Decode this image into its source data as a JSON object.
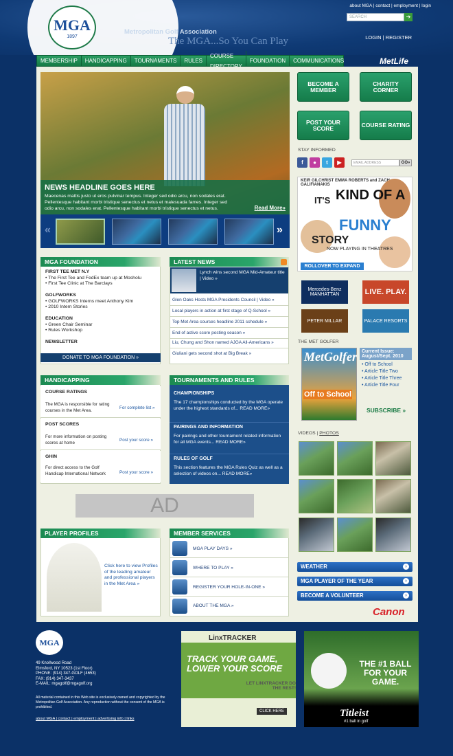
{
  "header": {
    "logo_text": "MGA",
    "logo_year": "1897",
    "org": "Metropolitan Golf Association",
    "tagline": "The MGA...So You Can Play",
    "top_links": [
      "about MGA",
      "contact",
      "employment",
      "login"
    ],
    "search_placeholder": "SEARCH",
    "login": "LOGIN",
    "register": "REGISTER",
    "sponsor": "MetLife"
  },
  "nav": [
    "MEMBERSHIP",
    "HANDICAPPING",
    "TOURNAMENTS",
    "RULES",
    "COURSE DIRECTORY",
    "FOUNDATION",
    "COMMUNICATIONS"
  ],
  "hero": {
    "headline": "NEWS HEADLINE GOES HERE",
    "body": "Maecenas mattis justo ut eros pulvinar tempus. Integer sed odio arcu, non sodales erat. Pellentesque habitant morbi tristique senectus et netus et malesuada fames. Integer sed odio arcu, non sodales erat. Pellentesque habitant morbi tristique senectus et netus.",
    "more": "Read More»"
  },
  "buttons": {
    "member": "BECOME A MEMBER",
    "charity": "CHARITY CORNER",
    "score": "POST YOUR SCORE",
    "rating": "COURSE RATING"
  },
  "stay": {
    "title": "STAY INFORMED",
    "email_placeholder": "EMAIL ADDRESS",
    "go": "GO»"
  },
  "movie": {
    "names": "KEIR GILCHRIST   EMMA ROBERTS   and ZACH GALIFIANAKIS",
    "its": "IT'S",
    "kind": "KIND OF A",
    "funny": "FUNNY",
    "story": "STORY",
    "now": "NOW PLAYING IN THEATRES",
    "rollover": "ROLLOVER TO EXPAND"
  },
  "sponsors": [
    "Mercedes-Benz MANHATTAN",
    "LIVE. PLAY.",
    "PETER MILLAR",
    "PALACE RESORTS"
  ],
  "met_golfer": {
    "title": "THE MET GOLFER",
    "cover": "MetGolfer",
    "cover_sub": "Off to School",
    "current": "Current Issue: August/Sept. 2010",
    "items": [
      "Off to School",
      "Article Title Two",
      "Article Title Three",
      "Article Title Four"
    ],
    "subscribe": "SUBSCRIBE »"
  },
  "videos": {
    "videos": "VIDEOS",
    "photos": "PHOTOS"
  },
  "right_links": [
    "WEATHER",
    "MGA PLAYER OF THE YEAR",
    "BECOME A VOLUNTEER"
  ],
  "canon": "Canon",
  "foundation": {
    "title": "MGA FOUNDATION",
    "sections": [
      {
        "h": "FIRST TEE MET N.Y",
        "items": [
          "• The First Tee and FedEx team up at Mosholu",
          "• First Tee Clinic at The Barclays"
        ]
      },
      {
        "h": "GOLFWORKS",
        "items": [
          "• GOLFWORKS Interns meet Anthony Kim",
          "• 2010 Intern Stories"
        ]
      },
      {
        "h": "EDUCATION",
        "items": [
          "• Green Chair Seminar",
          "• Rules Workshop"
        ]
      },
      {
        "h": "NEWSLETTER",
        "items": []
      }
    ],
    "donate": "DONATE TO MGA FOUNDATION »"
  },
  "news": {
    "title": "LATEST NEWS",
    "feature": "Lynch wins second MGA Mid-Amateur title | Video »",
    "items": [
      "Glen Oaks Hosts MGA Presidents Council | Video »",
      "Local players in action at first stage of Q-School »",
      "Top Met Area courses headline 2011 schedule »",
      "End of active score posting season »",
      "Liu, Chung and Shon named AJGA All-Americans »",
      "Giuliani gets second shot at Big Break »"
    ]
  },
  "handicap": {
    "title": "HANDICAPPING",
    "rows": [
      {
        "h": "COURSE RATINGS",
        "t": "The MGA is responsible for rating courses in the Met Area.",
        "l": "For complete list »"
      },
      {
        "h": "POST SCORES",
        "t": "For more information on posting scores at home",
        "l": "Post your score »"
      },
      {
        "h": "GHIN",
        "t": "For direct access to the Golf Handicap International Network",
        "l": "Post your score »"
      }
    ]
  },
  "tournaments": {
    "title": "TOURNAMENTS AND RULES",
    "sections": [
      {
        "h": "CHAMPIONSHIPS",
        "t": "The 17 championships conducted by the MGA operate under the highest standards of... READ MORE»"
      },
      {
        "h": "PAIRINGS AND INFORMATION",
        "t": "For pairings and other tournament related information for all MGA events... READ MORE»"
      },
      {
        "h": "RULES OF GOLF",
        "t": "This section features the MGA Rules Quiz as well as a selection of videos on... READ MORE»"
      }
    ]
  },
  "ad": "AD",
  "profiles": {
    "title": "PLAYER PROFILES",
    "text": "Click here to view Profiles of the leading amateur and professional players in the Met Area »"
  },
  "services": {
    "title": "MEMBER SERVICES",
    "items": [
      "MGA PLAY DAYS »",
      "WHERE TO PLAY »",
      "REGISTER YOUR HOLE-IN-ONE »",
      "ABOUT THE MGA »"
    ]
  },
  "footer": {
    "logo": "MGA",
    "address": [
      "49 Knollwood Road",
      "Elmsford, NY 10523 (1st Floor)",
      "PHONE: (914) 347-GOLF (4653)",
      "FAX: (914) 347-3437",
      "E-MAIL: mgagolf@mgagolf.org"
    ],
    "copy": "All material contained in this Web site is exclusively owned and copyrighted by the Metropolitan Golf Association. Any reproduction without the consent of the MGA is prohibited.",
    "links": "about MGA | contact | employment | advertising info | links"
  },
  "ad_linx": {
    "name": "LinxTRACKER",
    "tag": "TRACK YOUR GAME, LOWER YOUR SCORE",
    "let": "LET LINXTRACKER DO THE REST!",
    "click": "CLICK HERE"
  },
  "ad_titleist": {
    "tag": "THE #1 BALL FOR YOUR GAME.",
    "brand": "Titleist",
    "sub": "#1 ball in golf"
  }
}
